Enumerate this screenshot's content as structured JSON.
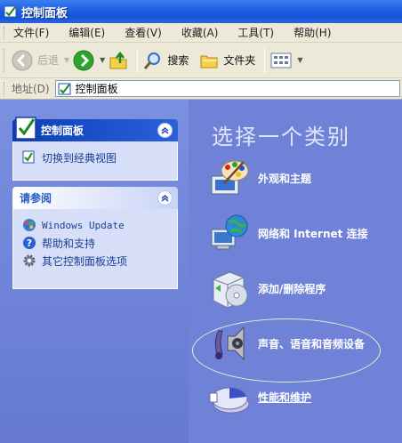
{
  "window": {
    "title": "控制面板"
  },
  "menu": [
    "文件(F)",
    "编辑(E)",
    "查看(V)",
    "收藏(A)",
    "工具(T)",
    "帮助(H)"
  ],
  "toolbar": {
    "back": "后退",
    "search": "搜索",
    "folders": "文件夹"
  },
  "address": {
    "label": "地址(D)",
    "value": "控制面板"
  },
  "panel_main": {
    "title": "控制面板",
    "switch_view": "切换到经典视图"
  },
  "panel_see_also": {
    "title": "请参阅",
    "items": [
      "Windows Update",
      "帮助和支持",
      "其它控制面板选项"
    ]
  },
  "main": {
    "heading": "选择一个类别",
    "categories": [
      {
        "label": "外观和主题",
        "icon": "appearance-icon"
      },
      {
        "label": "网络和 Internet 连接",
        "icon": "network-icon"
      },
      {
        "label": "添加/删除程序",
        "icon": "add-remove-icon"
      },
      {
        "label": "声音、语音和音频设备",
        "icon": "sound-icon"
      },
      {
        "label": "性能和维护",
        "icon": "performance-icon"
      }
    ]
  },
  "colors": {
    "title_bar": "#1f5fe0",
    "pane_bg": "#6f82d8",
    "heading": "#dfe6fb"
  }
}
